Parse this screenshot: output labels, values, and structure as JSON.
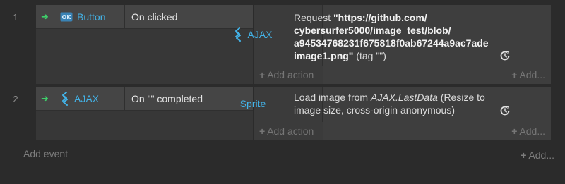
{
  "events": [
    {
      "number": "1",
      "condition": {
        "arrow": "➜",
        "object_icon": "button-icon",
        "object_name": "Button",
        "text": "On clicked"
      },
      "action": {
        "object_icon": "ajax-icon",
        "object_name": "AJAX",
        "text_prefix": "Request ",
        "url_line1": "\"https://github.com/",
        "url_line2": "cybersurfer5000/image_test/blob/",
        "url_line3": "a94534768231f675818f0ab67244a9ac7ade",
        "url_line4": "image1.png\"",
        "text_suffix": " (tag \"\")",
        "add_action": "Add action",
        "add_more": "Add..."
      }
    },
    {
      "number": "2",
      "condition": {
        "arrow": "➜",
        "object_icon": "ajax-icon",
        "object_name": "AJAX",
        "text": "On \"\" completed"
      },
      "action": {
        "object_name": "Sprite",
        "text_prefix": "Load image from ",
        "italic": "AJAX.LastData",
        "text_suffix": " (Resize to image size, cross-origin anonymous)",
        "add_action": "Add action",
        "add_more": "Add..."
      }
    }
  ],
  "footer": {
    "add_event": "Add event",
    "add_more": "Add..."
  },
  "colors": {
    "object_name": "#43b3e8",
    "arrow": "#3ecf6a",
    "background": "#2b2b2b"
  }
}
